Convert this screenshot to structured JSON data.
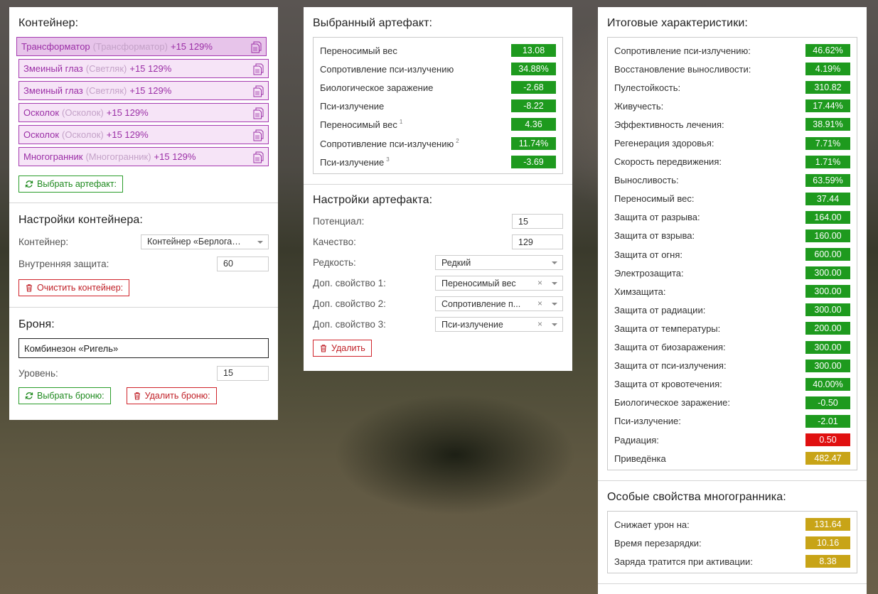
{
  "container_panel": {
    "title": "Контейнер:",
    "artifacts": [
      {
        "name": "Трансформатор",
        "alias": "(Трансформатор)",
        "bonus": "+15 129%"
      },
      {
        "name": "Змеиный глаз",
        "alias": "(Светляк)",
        "bonus": "+15 129%"
      },
      {
        "name": "Змеиный глаз",
        "alias": "(Светляк)",
        "bonus": "+15 129%"
      },
      {
        "name": "Осколок",
        "alias": "(Осколок)",
        "bonus": "+15 129%"
      },
      {
        "name": "Осколок",
        "alias": "(Осколок)",
        "bonus": "+15 129%"
      },
      {
        "name": "Многогранник",
        "alias": "(Многогранник)",
        "bonus": "+15 129%"
      }
    ],
    "choose_artifact_label": "Выбрать артефакт:",
    "settings_title": "Настройки контейнера:",
    "container_label": "Контейнер:",
    "container_value": "Контейнер «Берлога…",
    "inner_protection_label": "Внутренняя защита:",
    "inner_protection_value": "60",
    "clear_label": "Очистить контейнер:",
    "armor_title": "Броня:",
    "armor_name": "Комбинезон «Ригель»",
    "level_label": "Уровень:",
    "level_value": "15",
    "choose_armor_label": "Выбрать броню:",
    "delete_armor_label": "Удалить броню:"
  },
  "artifact_panel": {
    "title": "Выбранный артефакт:",
    "stats": [
      {
        "label": "Переносимый вес",
        "sup": "",
        "value": "13.08"
      },
      {
        "label": "Сопротивление пси-излучению",
        "sup": "",
        "value": "34.88%"
      },
      {
        "label": "Биологическое заражение",
        "sup": "",
        "value": "-2.68"
      },
      {
        "label": "Пси-излучение",
        "sup": "",
        "value": "-8.22"
      },
      {
        "label": "Переносимый вес",
        "sup": "1",
        "value": "4.36"
      },
      {
        "label": "Сопротивление пси-излучению",
        "sup": "2",
        "value": "11.74%"
      },
      {
        "label": "Пси-излучение",
        "sup": "3",
        "value": "-3.69"
      }
    ],
    "settings_title": "Настройки артефакта:",
    "potential_label": "Потенциал:",
    "potential_value": "15",
    "quality_label": "Качество:",
    "quality_value": "129",
    "rarity_label": "Редкость:",
    "rarity_value": "Редкий",
    "prop1_label": "Доп. свойство 1:",
    "prop1_value": "Переносимый вес",
    "prop2_label": "Доп. свойство 2:",
    "prop2_value": "Сопротивление п...",
    "prop3_label": "Доп. свойство 3:",
    "prop3_value": "Пси-излучение",
    "clear_glyph": "×",
    "delete_label": "Удалить"
  },
  "totals_panel": {
    "title": "Итоговые характеристики:",
    "stats": [
      {
        "label": "Сопротивление пси-излучению:",
        "value": "46.62%",
        "color": "green"
      },
      {
        "label": "Восстановление выносливости:",
        "value": "4.19%",
        "color": "green"
      },
      {
        "label": "Пулестойкость:",
        "value": "310.82",
        "color": "green"
      },
      {
        "label": "Живучесть:",
        "value": "17.44%",
        "color": "green"
      },
      {
        "label": "Эффективность лечения:",
        "value": "38.91%",
        "color": "green"
      },
      {
        "label": "Регенерация здоровья:",
        "value": "7.71%",
        "color": "green"
      },
      {
        "label": "Скорость передвижения:",
        "value": "1.71%",
        "color": "green"
      },
      {
        "label": "Выносливость:",
        "value": "63.59%",
        "color": "green"
      },
      {
        "label": "Переносимый вес:",
        "value": "37.44",
        "color": "green"
      },
      {
        "label": "Защита от разрыва:",
        "value": "164.00",
        "color": "green"
      },
      {
        "label": "Защита от взрыва:",
        "value": "160.00",
        "color": "green"
      },
      {
        "label": "Защита от огня:",
        "value": "600.00",
        "color": "green"
      },
      {
        "label": "Электрозащита:",
        "value": "300.00",
        "color": "green"
      },
      {
        "label": "Химзащита:",
        "value": "300.00",
        "color": "green"
      },
      {
        "label": "Защита от радиации:",
        "value": "300.00",
        "color": "green"
      },
      {
        "label": "Защита от температуры:",
        "value": "200.00",
        "color": "green"
      },
      {
        "label": "Защита от биозаражения:",
        "value": "300.00",
        "color": "green"
      },
      {
        "label": "Защита от пси-излучения:",
        "value": "300.00",
        "color": "green"
      },
      {
        "label": "Защита от кровотечения:",
        "value": "40.00%",
        "color": "green"
      },
      {
        "label": "Биологическое заражение:",
        "value": "-0.50",
        "color": "green"
      },
      {
        "label": "Пси-излучение:",
        "value": "-2.01",
        "color": "green"
      },
      {
        "label": "Радиация:",
        "value": "0.50",
        "color": "red"
      },
      {
        "label": "Приведёнка",
        "value": "482.47",
        "color": "gold"
      }
    ],
    "special_title": "Особые свойства многогранника:",
    "special": [
      {
        "label": "Снижает урон на:",
        "value": "131.64"
      },
      {
        "label": "Время перезарядки:",
        "value": "10.16"
      },
      {
        "label": "Заряда тратится при активации:",
        "value": "8.38"
      }
    ]
  },
  "colors": {
    "green": "#1e9a1e",
    "red": "#e01010",
    "gold": "#c8a417",
    "artifact_purple": "#9b2fa6"
  }
}
